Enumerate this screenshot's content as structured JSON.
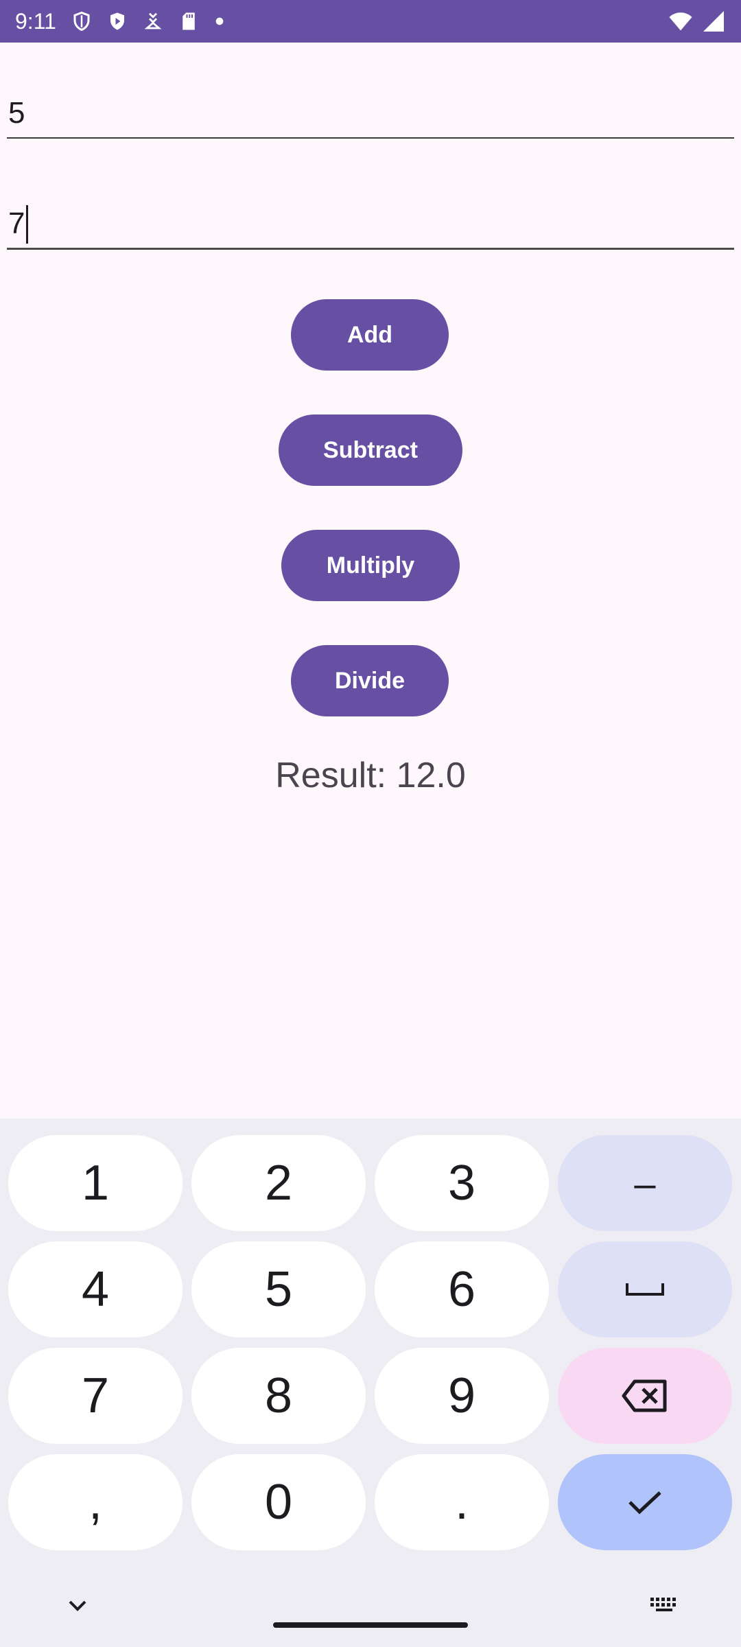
{
  "status_bar": {
    "time": "9:11",
    "icons_left": [
      "shield-icon",
      "play-shield-icon",
      "download-icon",
      "sd-card-icon",
      "dot-icon"
    ],
    "icons_right": [
      "wifi-icon",
      "signal-icon"
    ],
    "color": "#6750a4"
  },
  "inputs": {
    "first_value": "5",
    "second_value": "7"
  },
  "buttons": {
    "add": "Add",
    "subtract": "Subtract",
    "multiply": "Multiply",
    "divide": "Divide"
  },
  "result": {
    "text": "Result: 12.0"
  },
  "keyboard": {
    "keys": [
      "1",
      "2",
      "3",
      "–",
      "4",
      "5",
      "6",
      "␣",
      "7",
      "8",
      "9",
      "backspace",
      ",",
      "0",
      ".",
      "done"
    ],
    "row1": {
      "k1": "1",
      "k2": "2",
      "k3": "3",
      "k4": "–"
    },
    "row2": {
      "k1": "4",
      "k2": "5",
      "k3": "6"
    },
    "row3": {
      "k1": "7",
      "k2": "8",
      "k3": "9"
    },
    "row4": {
      "k1": ",",
      "k2": "0",
      "k3": "."
    }
  },
  "navigation": {
    "left_icon": "chevron-down-icon",
    "right_icon": "keyboard-icon"
  },
  "colors": {
    "primary": "#6750a4",
    "background": "#fef7fb",
    "keyboard_bg": "#efedf4",
    "key_mod": "#dee0f6",
    "key_delete": "#f9d8f3",
    "key_done": "#b0c4fb"
  }
}
